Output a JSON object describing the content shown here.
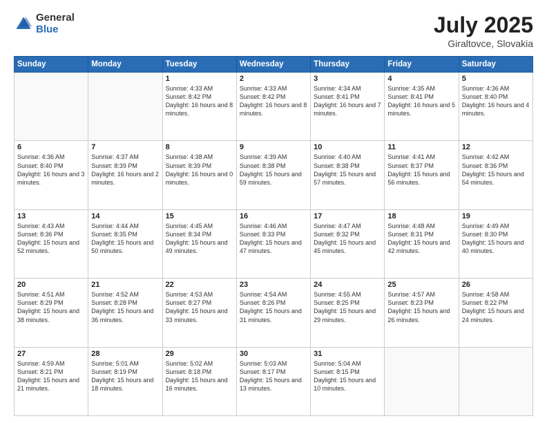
{
  "logo": {
    "general": "General",
    "blue": "Blue"
  },
  "title": {
    "month": "July 2025",
    "location": "Giraltovce, Slovakia"
  },
  "weekdays": [
    "Sunday",
    "Monday",
    "Tuesday",
    "Wednesday",
    "Thursday",
    "Friday",
    "Saturday"
  ],
  "weeks": [
    [
      {
        "day": "",
        "sunrise": "",
        "sunset": "",
        "daylight": ""
      },
      {
        "day": "",
        "sunrise": "",
        "sunset": "",
        "daylight": ""
      },
      {
        "day": "1",
        "sunrise": "Sunrise: 4:33 AM",
        "sunset": "Sunset: 8:42 PM",
        "daylight": "Daylight: 16 hours and 8 minutes."
      },
      {
        "day": "2",
        "sunrise": "Sunrise: 4:33 AM",
        "sunset": "Sunset: 8:42 PM",
        "daylight": "Daylight: 16 hours and 8 minutes."
      },
      {
        "day": "3",
        "sunrise": "Sunrise: 4:34 AM",
        "sunset": "Sunset: 8:41 PM",
        "daylight": "Daylight: 16 hours and 7 minutes."
      },
      {
        "day": "4",
        "sunrise": "Sunrise: 4:35 AM",
        "sunset": "Sunset: 8:41 PM",
        "daylight": "Daylight: 16 hours and 5 minutes."
      },
      {
        "day": "5",
        "sunrise": "Sunrise: 4:36 AM",
        "sunset": "Sunset: 8:40 PM",
        "daylight": "Daylight: 16 hours and 4 minutes."
      }
    ],
    [
      {
        "day": "6",
        "sunrise": "Sunrise: 4:36 AM",
        "sunset": "Sunset: 8:40 PM",
        "daylight": "Daylight: 16 hours and 3 minutes."
      },
      {
        "day": "7",
        "sunrise": "Sunrise: 4:37 AM",
        "sunset": "Sunset: 8:39 PM",
        "daylight": "Daylight: 16 hours and 2 minutes."
      },
      {
        "day": "8",
        "sunrise": "Sunrise: 4:38 AM",
        "sunset": "Sunset: 8:39 PM",
        "daylight": "Daylight: 16 hours and 0 minutes."
      },
      {
        "day": "9",
        "sunrise": "Sunrise: 4:39 AM",
        "sunset": "Sunset: 8:38 PM",
        "daylight": "Daylight: 15 hours and 59 minutes."
      },
      {
        "day": "10",
        "sunrise": "Sunrise: 4:40 AM",
        "sunset": "Sunset: 8:38 PM",
        "daylight": "Daylight: 15 hours and 57 minutes."
      },
      {
        "day": "11",
        "sunrise": "Sunrise: 4:41 AM",
        "sunset": "Sunset: 8:37 PM",
        "daylight": "Daylight: 15 hours and 56 minutes."
      },
      {
        "day": "12",
        "sunrise": "Sunrise: 4:42 AM",
        "sunset": "Sunset: 8:36 PM",
        "daylight": "Daylight: 15 hours and 54 minutes."
      }
    ],
    [
      {
        "day": "13",
        "sunrise": "Sunrise: 4:43 AM",
        "sunset": "Sunset: 8:36 PM",
        "daylight": "Daylight: 15 hours and 52 minutes."
      },
      {
        "day": "14",
        "sunrise": "Sunrise: 4:44 AM",
        "sunset": "Sunset: 8:35 PM",
        "daylight": "Daylight: 15 hours and 50 minutes."
      },
      {
        "day": "15",
        "sunrise": "Sunrise: 4:45 AM",
        "sunset": "Sunset: 8:34 PM",
        "daylight": "Daylight: 15 hours and 49 minutes."
      },
      {
        "day": "16",
        "sunrise": "Sunrise: 4:46 AM",
        "sunset": "Sunset: 8:33 PM",
        "daylight": "Daylight: 15 hours and 47 minutes."
      },
      {
        "day": "17",
        "sunrise": "Sunrise: 4:47 AM",
        "sunset": "Sunset: 8:32 PM",
        "daylight": "Daylight: 15 hours and 45 minutes."
      },
      {
        "day": "18",
        "sunrise": "Sunrise: 4:48 AM",
        "sunset": "Sunset: 8:31 PM",
        "daylight": "Daylight: 15 hours and 42 minutes."
      },
      {
        "day": "19",
        "sunrise": "Sunrise: 4:49 AM",
        "sunset": "Sunset: 8:30 PM",
        "daylight": "Daylight: 15 hours and 40 minutes."
      }
    ],
    [
      {
        "day": "20",
        "sunrise": "Sunrise: 4:51 AM",
        "sunset": "Sunset: 8:29 PM",
        "daylight": "Daylight: 15 hours and 38 minutes."
      },
      {
        "day": "21",
        "sunrise": "Sunrise: 4:52 AM",
        "sunset": "Sunset: 8:28 PM",
        "daylight": "Daylight: 15 hours and 36 minutes."
      },
      {
        "day": "22",
        "sunrise": "Sunrise: 4:53 AM",
        "sunset": "Sunset: 8:27 PM",
        "daylight": "Daylight: 15 hours and 33 minutes."
      },
      {
        "day": "23",
        "sunrise": "Sunrise: 4:54 AM",
        "sunset": "Sunset: 8:26 PM",
        "daylight": "Daylight: 15 hours and 31 minutes."
      },
      {
        "day": "24",
        "sunrise": "Sunrise: 4:55 AM",
        "sunset": "Sunset: 8:25 PM",
        "daylight": "Daylight: 15 hours and 29 minutes."
      },
      {
        "day": "25",
        "sunrise": "Sunrise: 4:57 AM",
        "sunset": "Sunset: 8:23 PM",
        "daylight": "Daylight: 15 hours and 26 minutes."
      },
      {
        "day": "26",
        "sunrise": "Sunrise: 4:58 AM",
        "sunset": "Sunset: 8:22 PM",
        "daylight": "Daylight: 15 hours and 24 minutes."
      }
    ],
    [
      {
        "day": "27",
        "sunrise": "Sunrise: 4:59 AM",
        "sunset": "Sunset: 8:21 PM",
        "daylight": "Daylight: 15 hours and 21 minutes."
      },
      {
        "day": "28",
        "sunrise": "Sunrise: 5:01 AM",
        "sunset": "Sunset: 8:19 PM",
        "daylight": "Daylight: 15 hours and 18 minutes."
      },
      {
        "day": "29",
        "sunrise": "Sunrise: 5:02 AM",
        "sunset": "Sunset: 8:18 PM",
        "daylight": "Daylight: 15 hours and 16 minutes."
      },
      {
        "day": "30",
        "sunrise": "Sunrise: 5:03 AM",
        "sunset": "Sunset: 8:17 PM",
        "daylight": "Daylight: 15 hours and 13 minutes."
      },
      {
        "day": "31",
        "sunrise": "Sunrise: 5:04 AM",
        "sunset": "Sunset: 8:15 PM",
        "daylight": "Daylight: 15 hours and 10 minutes."
      },
      {
        "day": "",
        "sunrise": "",
        "sunset": "",
        "daylight": ""
      },
      {
        "day": "",
        "sunrise": "",
        "sunset": "",
        "daylight": ""
      }
    ]
  ]
}
